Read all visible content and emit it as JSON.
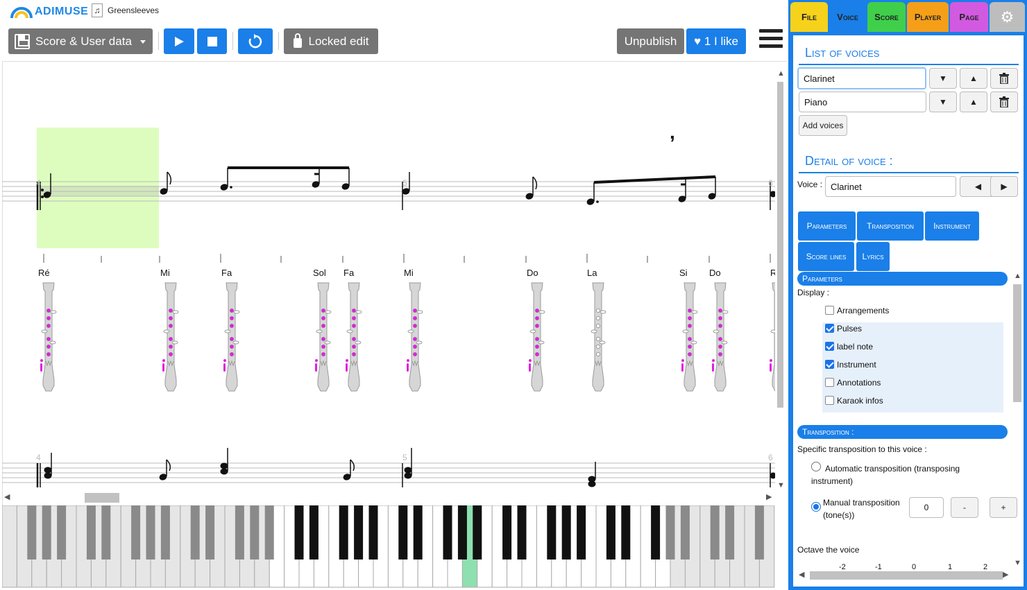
{
  "app": {
    "logo_text": "ADIMUSE",
    "document_title": "Greensleeves"
  },
  "toolbar": {
    "save_label": "Score & User data",
    "lock_label": "Locked edit",
    "unpublish_label": "Unpublish",
    "like_label": "♥ 1 I like"
  },
  "tabs": [
    {
      "label": "File",
      "color": "#f6d21b"
    },
    {
      "label": "Voice",
      "color": "#1a7fe8"
    },
    {
      "label": "Score",
      "color": "#3fcf4a"
    },
    {
      "label": "Player",
      "color": "#f59f18"
    },
    {
      "label": "Page",
      "color": "#d25ae0"
    }
  ],
  "voices_section": {
    "title": "List of voices",
    "voices": [
      "Clarinet",
      "Piano"
    ],
    "add_label": "Add voices"
  },
  "detail_section": {
    "title": "Detail of voice :",
    "voice_label": "Voice :",
    "voice_value": "Clarinet",
    "buttons": [
      "Parameters",
      "Transposition",
      "Instrument",
      "Score lines",
      "Lyrics"
    ]
  },
  "parameters": {
    "title": "Parameters",
    "display_label": "Display :",
    "options": [
      {
        "label": "Arrangements",
        "checked": false
      },
      {
        "label": "Pulses",
        "checked": true
      },
      {
        "label": "label note",
        "checked": true
      },
      {
        "label": "Instrument",
        "checked": true
      },
      {
        "label": "Annotations",
        "checked": false
      },
      {
        "label": "Karaok infos",
        "checked": false
      }
    ]
  },
  "transposition": {
    "title": "Transposition :",
    "subtitle": "Specific transposition to this voice :",
    "auto_label": "Automatic transposition (transposing instrument)",
    "manual_label": "Manual transposition (tone(s))",
    "manual_value": "0",
    "minus_label": "-",
    "plus_label": "+",
    "octave_label": "Octave the voice",
    "octave_values": [
      "-2",
      "-1",
      "0",
      "1",
      "2"
    ]
  },
  "score": {
    "measure_numbers": [
      "4",
      "5",
      "6"
    ],
    "note_labels": [
      "Ré",
      "Mi",
      "Fa",
      "Sol",
      "Fa",
      "Mi",
      "Do",
      "La",
      "Si",
      "Do",
      "R"
    ]
  },
  "colors": {
    "accent": "#1a7fe8",
    "highlight": "#ddfdbe",
    "fingering": "#e020e0",
    "active_key": "#8ee0b0"
  },
  "icons": [
    "floppy-icon",
    "play-icon",
    "stop-icon",
    "loop-icon",
    "lock-icon",
    "menu-icon",
    "gear-icon",
    "trash-icon"
  ]
}
